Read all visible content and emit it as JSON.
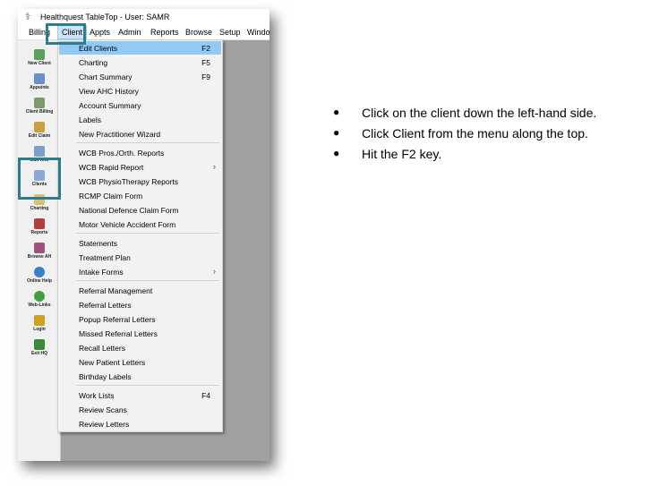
{
  "window": {
    "title": "Healthquest TableTop - User: SAMR"
  },
  "menubar": [
    "Billing",
    "Client",
    "Appts",
    "Admin",
    "Reports",
    "Browse",
    "Setup",
    "Window"
  ],
  "toolbar": [
    {
      "label": "New Client",
      "icon": "new-client-icon",
      "color": "#5aa05a"
    },
    {
      "label": "Appoints",
      "icon": "appointments-icon",
      "color": "#6a8fc8"
    },
    {
      "label": "Client Billing",
      "icon": "client-billing-icon",
      "color": "#7a9a6a"
    },
    {
      "label": "Edit Claim",
      "icon": "edit-claim-icon",
      "color": "#c8a040"
    },
    {
      "label": "Edit Hist",
      "icon": "edit-history-icon",
      "color": "#7aa0c8"
    },
    {
      "label": "Clients",
      "icon": "clients-icon",
      "color": "#8aa8d0"
    },
    {
      "label": "Charting",
      "icon": "charting-icon",
      "color": "#d8c070"
    },
    {
      "label": "Reports",
      "icon": "reports-icon",
      "color": "#b04040"
    },
    {
      "label": "Browse AH",
      "icon": "browse-icon",
      "color": "#a05080"
    },
    {
      "label": "Online Help",
      "icon": "help-icon",
      "color": "#3a80c8"
    },
    {
      "label": "Web-Links",
      "icon": "web-links-icon",
      "color": "#40a040"
    },
    {
      "label": "Login",
      "icon": "key-icon",
      "color": "#d0a020"
    },
    {
      "label": "Exit HQ",
      "icon": "exit-icon",
      "color": "#3a8a3a"
    }
  ],
  "client_menu": [
    {
      "label": "Edit Clients",
      "shortcut": "F2",
      "selected": true
    },
    {
      "label": "Charting",
      "shortcut": "F5"
    },
    {
      "label": "Chart Summary",
      "shortcut": "F9"
    },
    {
      "label": "View AHC History",
      "shortcut": ""
    },
    {
      "label": "Account Summary",
      "shortcut": ""
    },
    {
      "label": "Labels",
      "shortcut": ""
    },
    {
      "label": "New Practitioner Wizard",
      "shortcut": ""
    },
    {
      "label": "WCB Pros./Orth. Reports",
      "shortcut": ""
    },
    {
      "label": "WCB Rapid Report",
      "shortcut": "",
      "submenu": true
    },
    {
      "label": "WCB PhysioTherapy Reports",
      "shortcut": ""
    },
    {
      "label": "RCMP Claim Form",
      "shortcut": ""
    },
    {
      "label": "National Defence Claim Form",
      "shortcut": ""
    },
    {
      "label": "Motor Vehicle Accident Form",
      "shortcut": ""
    },
    {
      "label": "Statements",
      "shortcut": ""
    },
    {
      "label": "Treatment Plan",
      "shortcut": ""
    },
    {
      "label": "Intake Forms",
      "shortcut": "",
      "submenu": true
    },
    {
      "label": "Referral Management",
      "shortcut": ""
    },
    {
      "label": "Referral Letters",
      "shortcut": ""
    },
    {
      "label": "Popup Referral Letters",
      "shortcut": ""
    },
    {
      "label": "Missed Referral Letters",
      "shortcut": ""
    },
    {
      "label": "Recall Letters",
      "shortcut": ""
    },
    {
      "label": "New Patient Letters",
      "shortcut": ""
    },
    {
      "label": "Birthday Labels",
      "shortcut": ""
    },
    {
      "label": "Work Lists",
      "shortcut": "F4"
    },
    {
      "label": "Review Scans",
      "shortcut": ""
    },
    {
      "label": "Review Letters",
      "shortcut": ""
    }
  ],
  "instructions": [
    "Click on the client down the left-hand side.",
    "Click Client from the menu along the top.",
    "Hit the F2 key."
  ],
  "colors": {
    "highlight_box": "#2e7d8c",
    "menu_selection": "#91c9f7"
  }
}
